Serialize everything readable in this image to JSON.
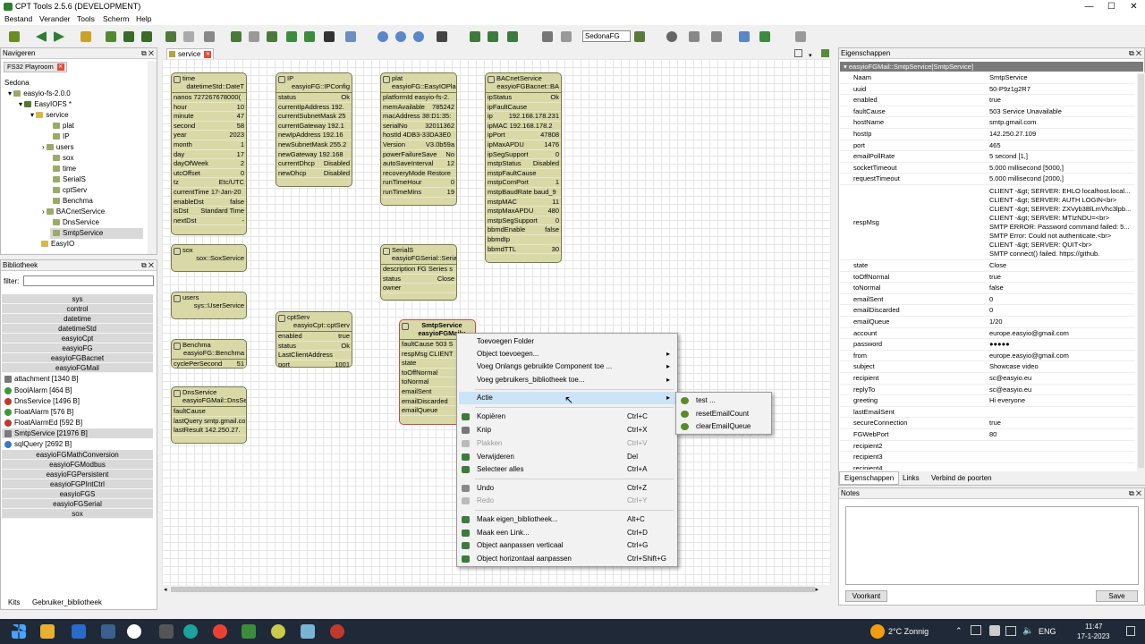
{
  "window": {
    "title": "CPT Tools 2.5.6 (DEVELOPMENT)",
    "min": "—",
    "max": "☐",
    "close": "✕"
  },
  "menu": [
    "Bestand",
    "Verander",
    "Tools",
    "Scherm",
    "Help"
  ],
  "toolbar": {
    "combo_value": "SedonaFG"
  },
  "nav": {
    "title": "Navigeren",
    "tab": "FS32 Playroom",
    "tree": [
      "Sedona",
      "easyio-fs-2.0.0",
      "EasyIOFS *",
      "service",
      "plat",
      "IP",
      "users",
      "sox",
      "time",
      "SerialS",
      "cptServ",
      "Benchma",
      "BACnetService",
      "DnsService",
      "SmtpService",
      "EasyIO"
    ]
  },
  "library": {
    "title": "Bibliotheek",
    "filter_label": "filter:",
    "sections_top": [
      "sys",
      "control",
      "datetime",
      "datetimeStd",
      "easyioCpt",
      "easyioFG",
      "easyioFGBacnet",
      "easyioFGMail"
    ],
    "items": [
      "attachment [1340 B]",
      "BoolAlarm [464 B]",
      "DnsService [1496 B]",
      "FloatAlarm [576 B]",
      "FloatAlarmEd [592 B]",
      "SmtpService [21976 B]",
      "sqlQuery [2692 B]"
    ],
    "sections_bottom": [
      "easyioFGMathConversion",
      "easyioFGModbus",
      "easyioFGPersistent",
      "easyioFGPIntCtrl",
      "easyioFGS",
      "easyioFGSerial",
      "sox"
    ],
    "bottom_tabs": [
      "Kits",
      "Gebruiker_bibliotheek"
    ]
  },
  "editor": {
    "tab": "service",
    "components": {
      "time": {
        "name": "time",
        "type": "datetimeStd::DateT",
        "rows": [
          [
            "nanos 727267678000(",
            ""
          ],
          [
            "hour",
            "10"
          ],
          [
            "minute",
            "47"
          ],
          [
            "second",
            "58"
          ],
          [
            "year",
            "2023"
          ],
          [
            "month",
            "1"
          ],
          [
            "day",
            "17"
          ],
          [
            "dayOfWeek",
            "2"
          ],
          [
            "utcOffset",
            "0"
          ],
          [
            "tz",
            "Etc/UTC"
          ],
          [
            "currentTime 17-Jan-20",
            ""
          ],
          [
            "enableDst",
            "false"
          ],
          [
            "isDst",
            "Standard Time"
          ],
          [
            "nextDst",
            "-"
          ]
        ]
      },
      "ip": {
        "name": "IP",
        "type": "easyioFG::IPConfig",
        "rows": [
          [
            "status",
            "Ok"
          ],
          [
            "currentIpAddress 192.",
            ""
          ],
          [
            "currentSubnetMask 25",
            ""
          ],
          [
            "currentGateway 192.1",
            ""
          ],
          [
            "newIpAddress 192.16",
            ""
          ],
          [
            "newSubnetMask 255.2",
            ""
          ],
          [
            "newGateway 192.168",
            ""
          ],
          [
            "currentDhcp",
            "Disabled"
          ],
          [
            "newDhcp",
            "Disabled"
          ]
        ]
      },
      "plat": {
        "name": "plat",
        "type": "easyioFG::EasyIOPla",
        "rows": [
          [
            "platformId easyio-fs-2.",
            ""
          ],
          [
            "memAvailable",
            "785242"
          ],
          [
            "macAddress 38:D1:35:",
            ""
          ],
          [
            "serialNo",
            "32011362"
          ],
          [
            "hostId 4DB3-33DA3E0",
            ""
          ],
          [
            "Version",
            "V3.0b59a"
          ],
          [
            "powerFailureSave",
            "No"
          ],
          [
            "autoSaveInterval",
            "12"
          ],
          [
            "recoveryMode Restore",
            ""
          ],
          [
            "runTimeHour",
            "0"
          ],
          [
            "runTimeMins",
            "19"
          ]
        ]
      },
      "bacnet": {
        "name": "BACnetService",
        "type": "easyioFGBacnet::BA",
        "rows": [
          [
            "ipStatus",
            "Ok"
          ],
          [
            "ipFaultCause",
            ""
          ],
          [
            "ip",
            "192.168.178.231"
          ],
          [
            "ipMAC 192.168.178.2",
            ""
          ],
          [
            "ipPort",
            "47808"
          ],
          [
            "ipMaxAPDU",
            "1476"
          ],
          [
            "ipSegSupport",
            "0"
          ],
          [
            "mstpStatus",
            "Disabled"
          ],
          [
            "mstpFaultCause",
            ""
          ],
          [
            "mstpComPort",
            "1"
          ],
          [
            "mstpBaudRate baud_9",
            ""
          ],
          [
            "mstpMAC",
            "11"
          ],
          [
            "mstpMaxAPDU",
            "480"
          ],
          [
            "mstpSegSupport",
            "0"
          ],
          [
            "bbmdEnable",
            "false"
          ],
          [
            "bbmdIp",
            ""
          ],
          [
            "bbmdTTL",
            "30"
          ]
        ]
      },
      "sox": {
        "name": "sox",
        "type": "sox::SoxService",
        "rows": []
      },
      "serials": {
        "name": "SerialS",
        "type": "easyioFGSerial::Seria",
        "rows": [
          [
            "description FG Series s",
            ""
          ],
          [
            "status",
            "Close"
          ],
          [
            "owner",
            ""
          ]
        ]
      },
      "users": {
        "name": "users",
        "type": "sys::UserService",
        "rows": []
      },
      "cptserv": {
        "name": "cptServ",
        "type": "easyioCpt::cptServ",
        "rows": [
          [
            "enabled",
            "true"
          ],
          [
            "status",
            "Ok"
          ],
          [
            "LastClientAddress",
            ""
          ],
          [
            "port",
            "1001"
          ]
        ]
      },
      "benchma": {
        "name": "Benchma",
        "type": "easyioFG::Benchma",
        "rows": [
          [
            "cyclePerSecond",
            "51"
          ]
        ]
      },
      "dns": {
        "name": "DnsService",
        "type": "easyioFGMail::DnsSe",
        "rows": [
          [
            "faultCause",
            ""
          ],
          [
            "lastQuery smtp.gmail.co",
            ""
          ],
          [
            "lastResult 142.250.27.",
            ""
          ]
        ]
      },
      "smtp": {
        "name": "SmtpService",
        "type": "easyioFGMail::",
        "rows": [
          [
            "faultCause 503 S",
            ""
          ],
          [
            "respMsg CLIENT",
            ""
          ],
          [
            "state",
            ""
          ],
          [
            "toOffNormal",
            ""
          ],
          [
            "toNormal",
            ""
          ],
          [
            "emailSent",
            ""
          ],
          [
            "emailDiscarded",
            ""
          ],
          [
            "emailQueue",
            ""
          ]
        ]
      }
    }
  },
  "context_menu": {
    "items": [
      {
        "label": "Toevoegen Folder",
        "shortcut": "",
        "arrow": "",
        "disabled": false
      },
      {
        "label": "Object toevoegen...",
        "shortcut": "",
        "arrow": "▸",
        "disabled": false
      },
      {
        "label": "Voeg Onlangs gebruikte Component toe ...",
        "shortcut": "",
        "arrow": "▸",
        "disabled": false
      },
      {
        "label": "Voeg gebruikers_bibliotheek toe...",
        "shortcut": "",
        "arrow": "▸",
        "disabled": false
      },
      {
        "label": "Actie",
        "shortcut": "",
        "arrow": "▸",
        "disabled": false
      },
      {
        "label": "Kopiëren",
        "shortcut": "Ctrl+C",
        "arrow": "",
        "disabled": false
      },
      {
        "label": "Knip",
        "shortcut": "Ctrl+X",
        "arrow": "",
        "disabled": false
      },
      {
        "label": "Plakken",
        "shortcut": "Ctrl+V",
        "arrow": "",
        "disabled": true
      },
      {
        "label": "Verwijderen",
        "shortcut": "Del",
        "arrow": "",
        "disabled": false
      },
      {
        "label": "Selecteer alles",
        "shortcut": "Ctrl+A",
        "arrow": "",
        "disabled": false
      },
      {
        "label": "Undo",
        "shortcut": "Ctrl+Z",
        "arrow": "",
        "disabled": false
      },
      {
        "label": "Redo",
        "shortcut": "Ctrl+Y",
        "arrow": "",
        "disabled": true
      },
      {
        "label": "Maak eigen_bibliotheek...",
        "shortcut": "Alt+C",
        "arrow": "",
        "disabled": false
      },
      {
        "label": "Maak een Link...",
        "shortcut": "Ctrl+D",
        "arrow": "",
        "disabled": false
      },
      {
        "label": "Object aanpassen verticaal",
        "shortcut": "Ctrl+G",
        "arrow": "",
        "disabled": false
      },
      {
        "label": "Object horizontaal aanpassen",
        "shortcut": "Ctrl+Shift+G",
        "arrow": "",
        "disabled": false
      }
    ],
    "submenu": [
      "test ...",
      "resetEmailCount",
      "clearEmailQueue"
    ]
  },
  "properties": {
    "title": "Eigenschappen",
    "header": "easyioFGMail::SmtpService[SmtpService]",
    "rows": [
      [
        "Naam",
        "SmtpService"
      ],
      [
        "uuid",
        "50-P9z1g2R7"
      ],
      [
        "enabled",
        "true"
      ],
      [
        "faultCause",
        "503 Service Unavailable"
      ],
      [
        "hostName",
        "smtp.gmail.com"
      ],
      [
        "hostIp",
        "142.250.27.109"
      ],
      [
        "port",
        "465"
      ],
      [
        "emailPollRate",
        "5 second [1,]"
      ],
      [
        "socketTimeout",
        "5.000 millisecond [5000,]"
      ],
      [
        "requestTimeout",
        "5.000 millisecond [2000,]"
      ]
    ],
    "respMsg_label": "respMsg",
    "respMsg_lines": [
      "CLIENT -&gt; SERVER: EHLO localhost.local...",
      "CLIENT -&gt; SERVER: AUTH LOGIN<br>",
      "CLIENT -&gt; SERVER: ZXVyb3BlLmVhc3lpb...",
      "CLIENT -&gt; SERVER: MTIzNDU=<br>",
      "SMTP ERROR: Password command failed: 5...",
      "SMTP Error: Could not authenticate.<br>",
      "CLIENT -&gt; SERVER: QUIT<br>",
      "SMTP connect() failed. https://github."
    ],
    "rows2": [
      [
        "state",
        "Close"
      ],
      [
        "toOffNormal",
        "true"
      ],
      [
        "toNormal",
        "false"
      ],
      [
        "emailSent",
        "0"
      ],
      [
        "emailDiscarded",
        "0"
      ],
      [
        "emailQueue",
        "1/20"
      ],
      [
        "account",
        "europe.easyio@gmail.com"
      ],
      [
        "password",
        "●●●●●"
      ],
      [
        "from",
        "europe.easyio@gmail.com"
      ],
      [
        "subject",
        "Showcase video"
      ],
      [
        "recipient",
        "sc@easyio.eu"
      ],
      [
        "replyTo",
        "sc@easyio.eu"
      ],
      [
        "greeting",
        "Hi everyone"
      ],
      [
        "lastEmailSent",
        ""
      ],
      [
        "secureConnection",
        "true"
      ],
      [
        "FGWebPort",
        "80"
      ],
      [
        "recipient2",
        ""
      ],
      [
        "recipient3",
        ""
      ],
      [
        "recipient4",
        ""
      ]
    ],
    "tabs": [
      "Eigenschappen",
      "Links",
      "Verbind de poorten"
    ]
  },
  "notes": {
    "title": "Notes",
    "prev_label": "Voorkant",
    "save_label": "Save"
  },
  "taskbar": {
    "weather": "2°C  Zonnig",
    "lang": "ENG",
    "time": "11:47",
    "date": "17-1-2023"
  }
}
